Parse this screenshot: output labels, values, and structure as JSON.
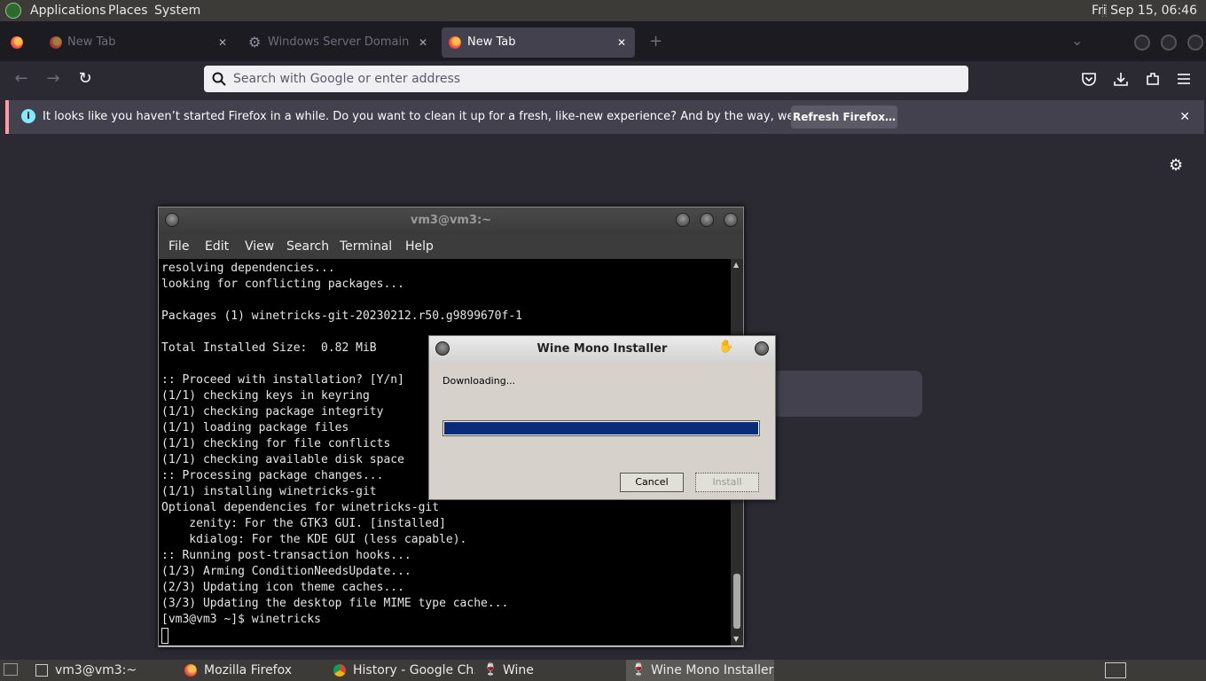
{
  "top_panel": {
    "menus": [
      "Applications",
      "Places",
      "System"
    ],
    "clock": "Fri Sep 15, 06:46"
  },
  "browser": {
    "tabs": [
      {
        "label": "New Tab",
        "active": false
      },
      {
        "label": "Windows Server Domain",
        "active": false
      },
      {
        "label": "New Tab",
        "active": true
      }
    ],
    "close_glyph": "✕",
    "new_tab_glyph": "+",
    "list_tabs_glyph": "⌄",
    "nav": {
      "back": "←",
      "forward": "→",
      "reload": "↻"
    },
    "url_placeholder": "Search with Google or enter address",
    "toolbar_icons": [
      "pocket-icon",
      "downloads-icon",
      "extensions-icon",
      "menu-icon"
    ],
    "notification": {
      "message": "It looks like you haven’t started Firefox in a while. Do you want to clean it up for a fresh, like-new experience? And by the way, welcome back!",
      "button": "Refresh Firefox…",
      "close": "✕"
    }
  },
  "terminal": {
    "title": "vm3@vm3:~",
    "menus": [
      "File",
      "Edit",
      "View",
      "Search",
      "Terminal",
      "Help"
    ],
    "lines": [
      "resolving dependencies...",
      "looking for conflicting packages...",
      "",
      "Packages (1) winetricks-git-20230212.r50.g9899670f-1",
      "",
      "Total Installed Size:  0.82 MiB",
      "",
      ":: Proceed with installation? [Y/n]",
      "(1/1) checking keys in keyring",
      "(1/1) checking package integrity",
      "(1/1) loading package files",
      "(1/1) checking for file conflicts",
      "(1/1) checking available disk space",
      ":: Processing package changes...",
      "(1/1) installing winetricks-git",
      "Optional dependencies for winetricks-git",
      "    zenity: For the GTK3 GUI. [installed]",
      "    kdialog: For the KDE GUI (less capable).",
      ":: Running post-transaction hooks...",
      "(1/3) Arming ConditionNeedsUpdate...",
      "(2/3) Updating icon theme caches...",
      "(3/3) Updating the desktop file MIME type cache...",
      "[vm3@vm3 ~]$ winetricks"
    ]
  },
  "dialog": {
    "title": "Wine Mono Installer",
    "status": "Downloading...",
    "progress": 1.0,
    "cancel": "Cancel",
    "install": "Install"
  },
  "taskbar": {
    "items": [
      {
        "label": "vm3@vm3:~",
        "icon": "terminal-icon"
      },
      {
        "label": "Mozilla Firefox",
        "icon": "firefox-icon"
      },
      {
        "label": "History - Google Ch...",
        "icon": "chrome-icon"
      },
      {
        "label": "Wine",
        "icon": "wine-icon"
      },
      {
        "label": "Wine Mono Installer",
        "icon": "wine-icon",
        "active": true
      }
    ]
  },
  "colors": {
    "accent_progress": "#0a2a7a",
    "notification_bar": "#ff9aa2",
    "info_icon": "#80ebff"
  }
}
